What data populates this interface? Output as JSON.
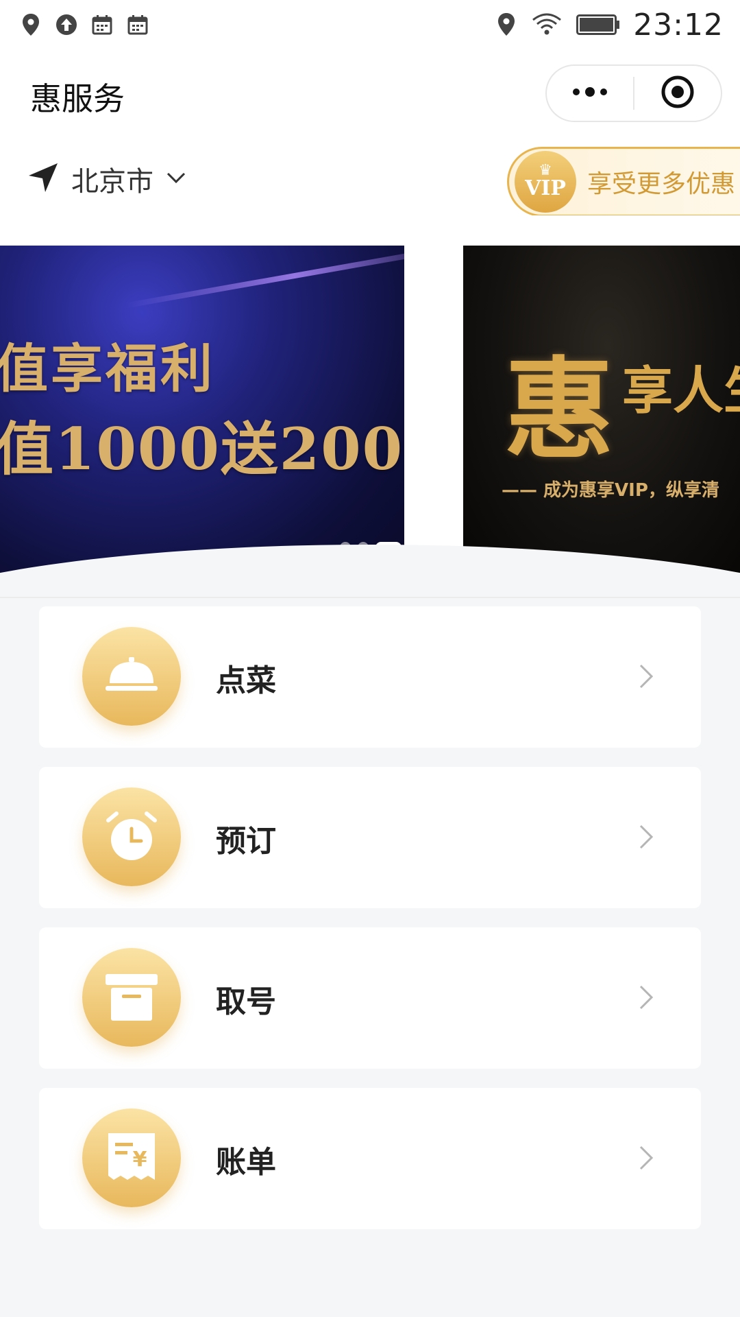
{
  "status_bar": {
    "time": "23:12",
    "left_icons": [
      "location-pin-icon",
      "upload-icon",
      "calendar-icon",
      "calendar-icon"
    ],
    "right_icons": [
      "location-pin-icon",
      "wifi-icon",
      "battery-icon"
    ]
  },
  "header": {
    "title": "惠服务",
    "capsule": {
      "more": "more-icon",
      "close": "target-icon"
    }
  },
  "location": {
    "city": "北京市"
  },
  "vip": {
    "badge": "VIP",
    "text": "享受更多优惠"
  },
  "banner": {
    "slide1_line1": "值享福利",
    "slide1_line2": "值1000送200",
    "slide2_big": "惠",
    "slide2_rest": "享人生",
    "slide2_sub": "—— 成为惠享VIP，纵享清",
    "dots": 3,
    "active_dot": 3
  },
  "menu": [
    {
      "label": "点菜",
      "icon": "dish-cover-icon"
    },
    {
      "label": "预订",
      "icon": "alarm-clock-icon"
    },
    {
      "label": "取号",
      "icon": "ticket-box-icon"
    },
    {
      "label": "账单",
      "icon": "receipt-icon"
    }
  ],
  "colors": {
    "accent": "#e8b85c",
    "vip_text": "#d29a34",
    "background": "#f5f6f8"
  }
}
